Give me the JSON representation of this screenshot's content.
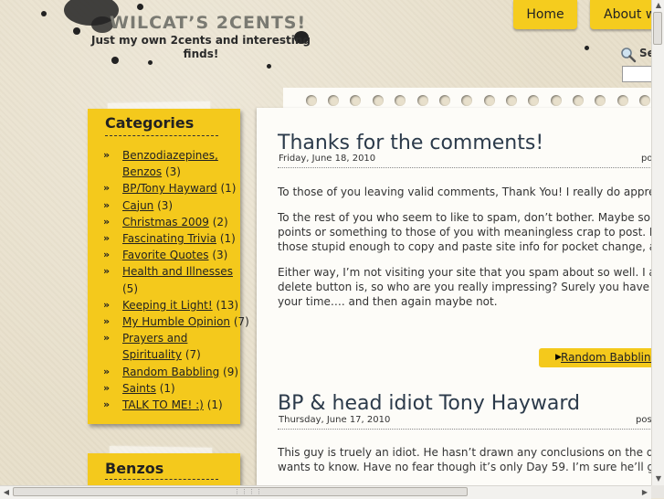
{
  "header": {
    "site_title": "WILCAT’S 2CENTS!",
    "tagline": "Just my own 2cents and interesting finds!"
  },
  "nav": {
    "items": [
      {
        "label": "Home"
      },
      {
        "label": "About wi"
      }
    ]
  },
  "search": {
    "label": "Se",
    "icon": "search-icon",
    "value": ""
  },
  "sidebar": {
    "categories_title": "Categories",
    "categories": [
      {
        "name": "Benzodiazepines, Benzos",
        "count": "(3)"
      },
      {
        "name": "BP/Tony Hayward",
        "count": "(1)"
      },
      {
        "name": "Cajun",
        "count": "(3)"
      },
      {
        "name": "Christmas 2009",
        "count": "(2)"
      },
      {
        "name": "Fascinating Trivia",
        "count": "(1)"
      },
      {
        "name": "Favorite Quotes",
        "count": "(3)"
      },
      {
        "name": "Health and Illnesses",
        "count": "(5)"
      },
      {
        "name": "Keeping it Light!",
        "count": "(13)"
      },
      {
        "name": "My Humble Opinion",
        "count": "(7)"
      },
      {
        "name": "Prayers and Spirituality",
        "count": "(7)"
      },
      {
        "name": "Random Babbling",
        "count": "(9)"
      },
      {
        "name": "Saints",
        "count": "(1)"
      },
      {
        "name": "TALK TO ME! :)",
        "count": "(1)"
      }
    ],
    "bullet": "»",
    "benzos_title": "Benzos"
  },
  "posts": [
    {
      "title": "Thanks for the comments!",
      "date": "Friday, June 18, 2010",
      "byline": "po",
      "paragraphs": [
        [
          "To those of you leaving valid comments, Thank You!  I really do appreciat"
        ],
        [
          "To the rest of you who seem to like to spam, don’t bother.  Maybe some",
          "points or something to those of you with meaningless crap to post.  Ma",
          "those stupid enough to copy and paste site info for pocket change, and"
        ],
        [
          "Either way, I’m not visiting your site that you spam about so well.  I also",
          "delete button is, so who are you really impressing?   Surely you have be",
          "your time…. and then again maybe not."
        ]
      ],
      "category_link": "Random Babbling"
    },
    {
      "title": "BP & head idiot Tony Hayward",
      "date": "Thursday, June 17, 2010",
      "byline": "pos",
      "paragraphs": [
        [
          "This guy is truely an idiot.  He hasn’t drawn any conclusions on the disa",
          "wants to know.   Have no fear though it’s only Day 59.  I’m sure he’ll get"
        ]
      ]
    }
  ],
  "colors": {
    "accent_yellow": "#f4c91c",
    "paper": "#fdfcf8",
    "background": "#e8e0cc",
    "post_title": "#2b3a4a"
  }
}
